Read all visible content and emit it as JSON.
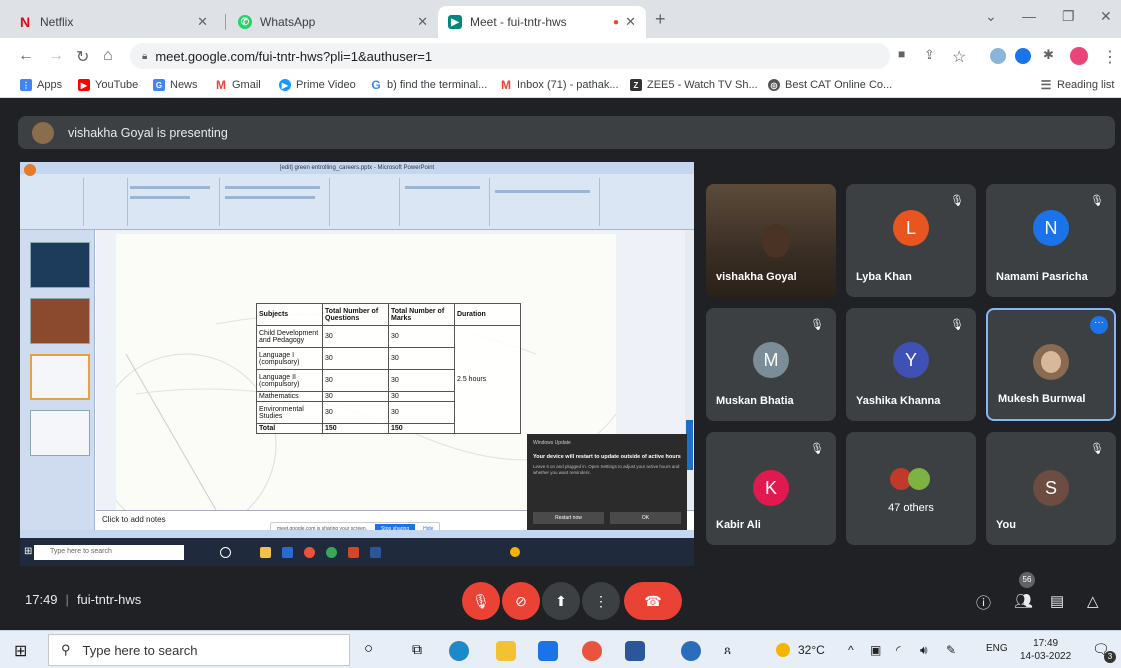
{
  "browser": {
    "tabs": [
      {
        "title": "Netflix",
        "icon": "netflix-icon",
        "color": "#e50914"
      },
      {
        "title": "WhatsApp",
        "icon": "whatsapp-icon",
        "color": "#25d366"
      },
      {
        "title": "Meet - fui-tntr-hws",
        "icon": "meet-icon",
        "color": "#00897b"
      }
    ],
    "url": "meet.google.com/fui-tntr-hws?pli=1&authuser=1",
    "bookmarks": [
      {
        "label": "Apps",
        "icon": "apps-grid-icon",
        "color": "#4285f4"
      },
      {
        "label": "YouTube",
        "icon": "youtube-icon",
        "color": "#ff0000"
      },
      {
        "label": "News",
        "icon": "news-icon",
        "color": "#4285f4"
      },
      {
        "label": "Gmail",
        "icon": "gmail-icon",
        "color": "#ea4335"
      },
      {
        "label": "Prime Video",
        "icon": "prime-video-icon",
        "color": "#1a98ff"
      },
      {
        "label": "b) find the terminal...",
        "icon": "google-icon",
        "color": "#4285f4"
      },
      {
        "label": "Inbox (71) - pathak...",
        "icon": "gmail-icon",
        "color": "#ea4335"
      },
      {
        "label": "ZEE5 - Watch TV Sh...",
        "icon": "zee5-icon",
        "color": "#333333"
      },
      {
        "label": "Best CAT Online Co...",
        "icon": "globe-icon",
        "color": "#555555"
      }
    ],
    "reading_list": "Reading list"
  },
  "meet": {
    "presenting_text": "vishakha Goyal is presenting",
    "meeting_time": "17:49",
    "meeting_code": "fui-tntr-hws",
    "participant_count": "56",
    "participants": [
      {
        "name": "vishakha Goyal",
        "initial": "",
        "color": "#6b5a48"
      },
      {
        "name": "Lyba Khan",
        "initial": "L",
        "color": "#e8551e"
      },
      {
        "name": "Namami Pasricha",
        "initial": "N",
        "color": "#1a73e8"
      },
      {
        "name": "Muskan Bhatia",
        "initial": "M",
        "color": "#7b8d98"
      },
      {
        "name": "Yashika Khanna",
        "initial": "Y",
        "color": "#3f51b5"
      },
      {
        "name": "Mukesh Burnwal",
        "initial": "",
        "color": "#8a6a50"
      },
      {
        "name": "Kabir Ali",
        "initial": "K",
        "color": "#e0194e"
      },
      {
        "name": "47 others",
        "initial": "",
        "color": "#5f6368"
      },
      {
        "name": "You",
        "initial": "S",
        "color": "#6d4c41"
      }
    ]
  },
  "shared_screen": {
    "window_title": "[edit] green entrolling_careers.pptx - Microsoft PowerPoint",
    "notes_placeholder": "Click to add notes",
    "table": {
      "headers": [
        "Subjects",
        "Total Number of Questions",
        "Total Number of Marks",
        "Duration"
      ],
      "rows": [
        [
          "Child Development and Pedagogy",
          "30",
          "30"
        ],
        [
          "Language I (compulsory)",
          "30",
          "30"
        ],
        [
          "Language II (compulsory)",
          "30",
          "30"
        ],
        [
          "Mathematics",
          "30",
          "30"
        ],
        [
          "Environmental Studies",
          "30",
          "30"
        ],
        [
          "Total",
          "150",
          "150"
        ]
      ],
      "duration": "2.5 hours"
    },
    "sharing_text": "meet.google.com is sharing your screen.",
    "stop_sharing": "Stop sharing",
    "hide": "Hide",
    "toast": {
      "header": "Windows Update",
      "title": "Your device will restart to update outside of active hours",
      "body": "Leave it on and plugged in. Open Settings to adjust your active hours and whether you want reminders.",
      "restart": "Restart now",
      "ok": "OK"
    },
    "inner_search": "Type here to search"
  },
  "taskbar": {
    "search_placeholder": "Type here to search",
    "weather": "32°C",
    "language": "ENG",
    "time": "17:49",
    "date": "14-03-2022",
    "notifications": "3"
  }
}
